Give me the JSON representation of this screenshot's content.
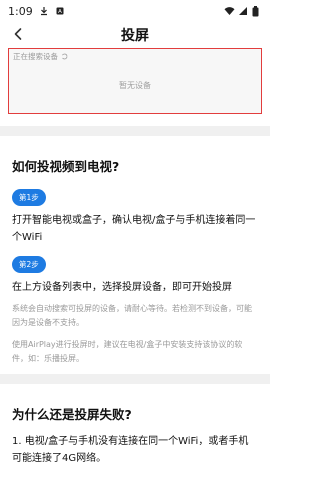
{
  "status_bar": {
    "time": "1:09",
    "download_icon": "download-icon",
    "sim_icon": "sim-icon",
    "wifi_icon": "wifi-icon",
    "signal_icon": "signal-icon",
    "battery_icon": "battery-icon"
  },
  "header": {
    "title": "投屏",
    "back_icon": "chevron-left-icon"
  },
  "device_panel": {
    "searching_text": "正在搜索设备",
    "no_device_text": "暂无设备",
    "border_color": "#e23d3d"
  },
  "howto": {
    "title": "如何投视频到电视?",
    "step1": {
      "label": "第1步",
      "text": "打开智能电视或盒子，确认电视/盒子与手机连接着同一个WiFi"
    },
    "step2": {
      "label": "第2步",
      "text": "在上方设备列表中，选择投屏设备，即可开始投屏"
    },
    "note1": "系统会自动搜索可投屏的设备，请耐心等待。若检测不到设备，可能因为是设备不支持。",
    "note2": "使用AirPlay进行投屏时，建议在电视/盒子中安装支持该协议的软件，如：乐播投屏。"
  },
  "fail": {
    "title": "为什么还是投屏失败?",
    "item1": "1. 电视/盒子与手机没有连接在同一个WiFi，或者手机可能连接了4G网络。"
  },
  "colors": {
    "accent": "#1e7be2"
  }
}
